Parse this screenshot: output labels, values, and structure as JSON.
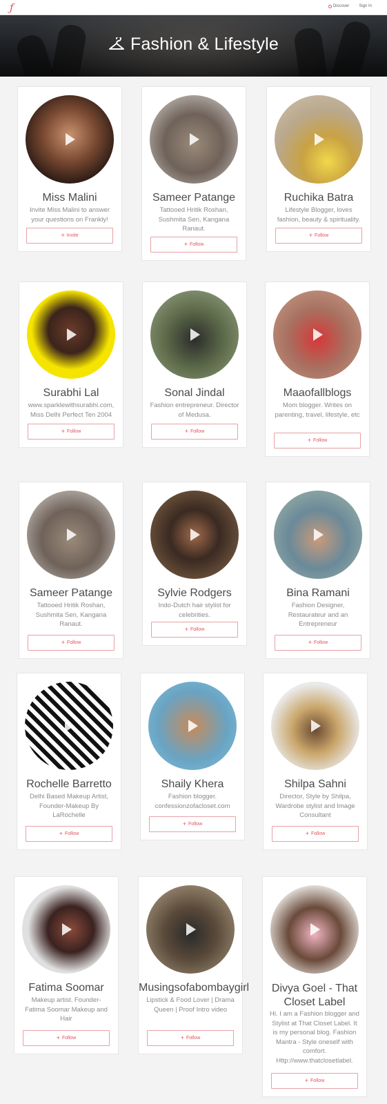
{
  "header": {
    "logo_glyph": "ƒ",
    "discover_label": "Discover",
    "signin_label": "Sign In"
  },
  "banner": {
    "title": "Fashion & Lifestyle",
    "icon": "hanger-icon"
  },
  "colors": {
    "accent": "#e0525e",
    "button_border": "#e7a0a6"
  },
  "profiles": [
    {
      "name": "Miss Malini",
      "bio": "Invite Miss Malini to answer your questions on Frankly!",
      "action": "Invite"
    },
    {
      "name": "Sameer Patange",
      "bio": "Tattooed Hritik Roshan, Sushmita Sen, Kangana Ranaut.",
      "action": "Follow"
    },
    {
      "name": "Ruchika Batra",
      "bio": "Lifestyle Blogger, loves fashion, beauty & spirituality.",
      "action": "Follow"
    },
    {
      "name": "Surabhi Lal",
      "bio": "www.sparklewithsurabhi.com, Miss Delhi Perfect Ten 2004",
      "action": "Follow"
    },
    {
      "name": "Sonal Jindal",
      "bio": "Fashion entrepreneur. Director of Medusa.",
      "action": "Follow"
    },
    {
      "name": "Maaofallblogs",
      "bio": "Mom blogger. Writes on parenting, travel, lifestyle, etc",
      "action": "Follow"
    },
    {
      "name": "Sameer Patange",
      "bio": "Tattooed Hritik Roshan, Sushmita Sen, Kangana Ranaut.",
      "action": "Follow"
    },
    {
      "name": "Sylvie Rodgers",
      "bio": "Indo-Dutch hair stylist for celebrities.",
      "action": "Follow"
    },
    {
      "name": "Bina Ramani",
      "bio": "Fashion Designer, Restaurateur and an Entrepreneur",
      "action": "Follow"
    },
    {
      "name": "Rochelle Barretto",
      "bio": "Delhi Based Makeup Artist, Founder-Makeup By LaRochelle",
      "action": "Follow"
    },
    {
      "name": "Shaily Khera",
      "bio": "Fashion blogger. confessionzofacloset.com",
      "action": "Follow"
    },
    {
      "name": "Shilpa Sahni",
      "bio": "Director, Style by Shilpa, Wardrobe stylist and Image Consultant",
      "action": "Follow"
    },
    {
      "name": "Fatima Soomar",
      "bio": "Makeup artist. Founder- Fatima Soomar Makeup and Hair",
      "action": "Follow"
    },
    {
      "name": "Musingsofabombaygirl",
      "bio": "Lipstick & Food Lover | Drama Queen | Proof Intro video",
      "action": "Follow"
    },
    {
      "name": "Divya Goel - That Closet Label",
      "bio": "Hi. I am a Fashion blogger and Stylist at That Closet Label. It is my personal blog. Fashion Mantra - Style oneself with comfort. Http://www.thatclosetlabel.",
      "action": "Follow"
    }
  ]
}
